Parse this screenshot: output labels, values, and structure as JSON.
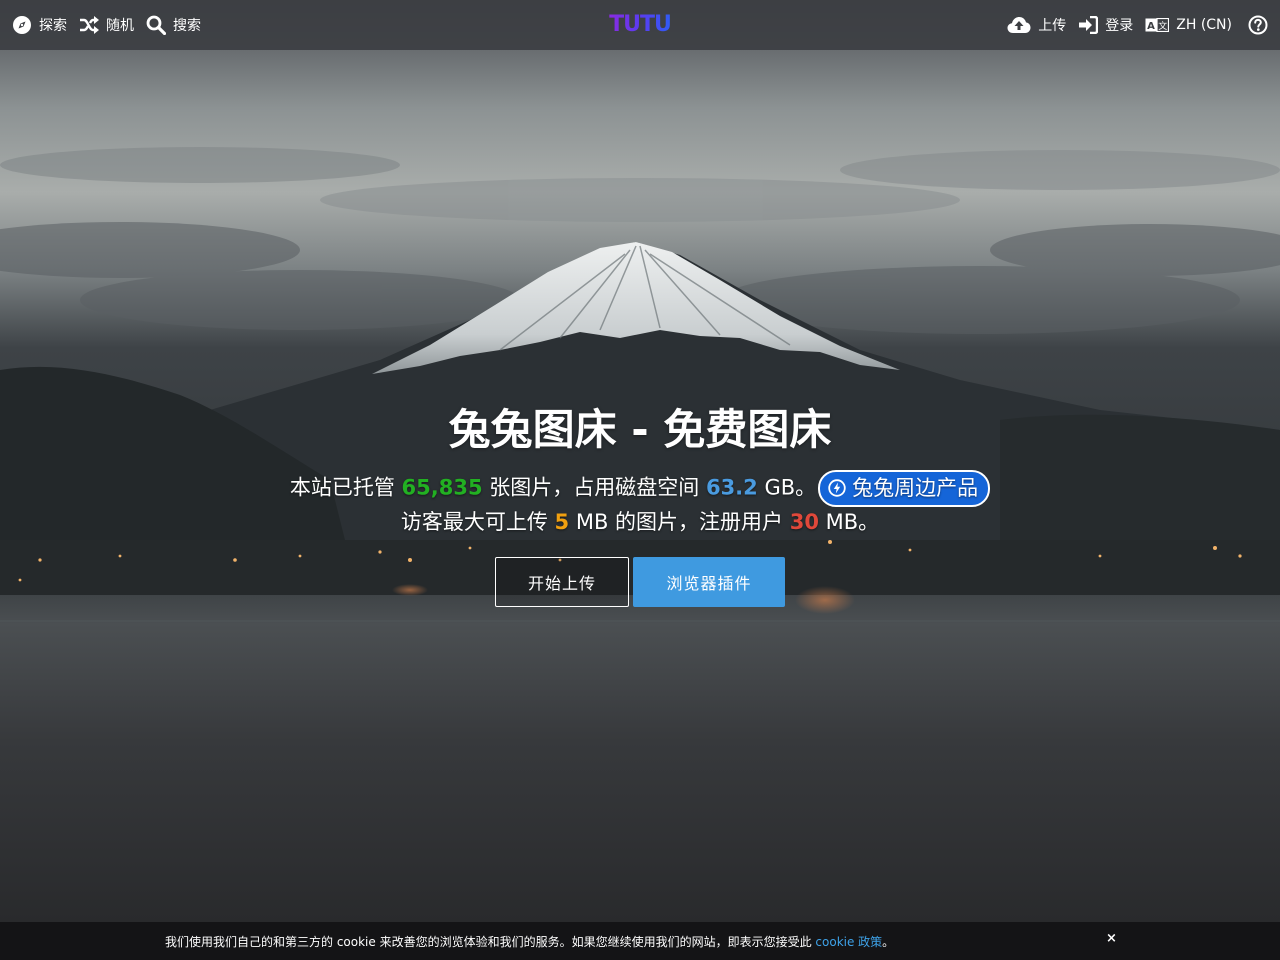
{
  "topbar": {
    "explore_label": "探索",
    "random_label": "随机",
    "search_label": "搜索",
    "logo_text": "TUTU",
    "upload_label": "上传",
    "login_label": "登录",
    "language_label": "ZH (CN)"
  },
  "hero": {
    "title": "兔兔图床 - 免费图床",
    "line1_prefix": "本站已托管 ",
    "image_count": "65,835",
    "line1_mid": " 张图片，占用磁盘空间 ",
    "disk_usage": "63.2",
    "line1_suffix": " GB。",
    "pill_label": "兔兔周边产品",
    "line2_prefix": "访客最大可上传 ",
    "guest_limit": "5",
    "line2_mid": " MB 的图片，注册用户 ",
    "user_limit": "30",
    "line2_suffix": " MB。",
    "start_upload_label": "开始上传",
    "browser_plugin_label": "浏览器插件"
  },
  "cookie": {
    "text": "我们使用我们自己的和第三方的 cookie 来改善您的浏览体验和我们的服务。如果您继续使用我们的网站，即表示您接受此 ",
    "link_text": "cookie 政策",
    "text_end": "。",
    "close_label": "×"
  },
  "colors": {
    "topbar_bg": "#3c3e42",
    "accent_blue": "#3f9ae0",
    "pill_blue": "#1565d8",
    "count_green": "#22b022",
    "disk_blue": "#4a9be0",
    "guest_orange": "#f0a010",
    "user_red": "#e0483a"
  },
  "icons": {
    "explore": "compass-icon",
    "random": "shuffle-icon",
    "search": "search-icon",
    "upload": "cloud-upload-icon",
    "login": "sign-in-icon",
    "language": "language-icon",
    "help": "question-circle-icon",
    "pill": "bolt-circle-icon"
  }
}
